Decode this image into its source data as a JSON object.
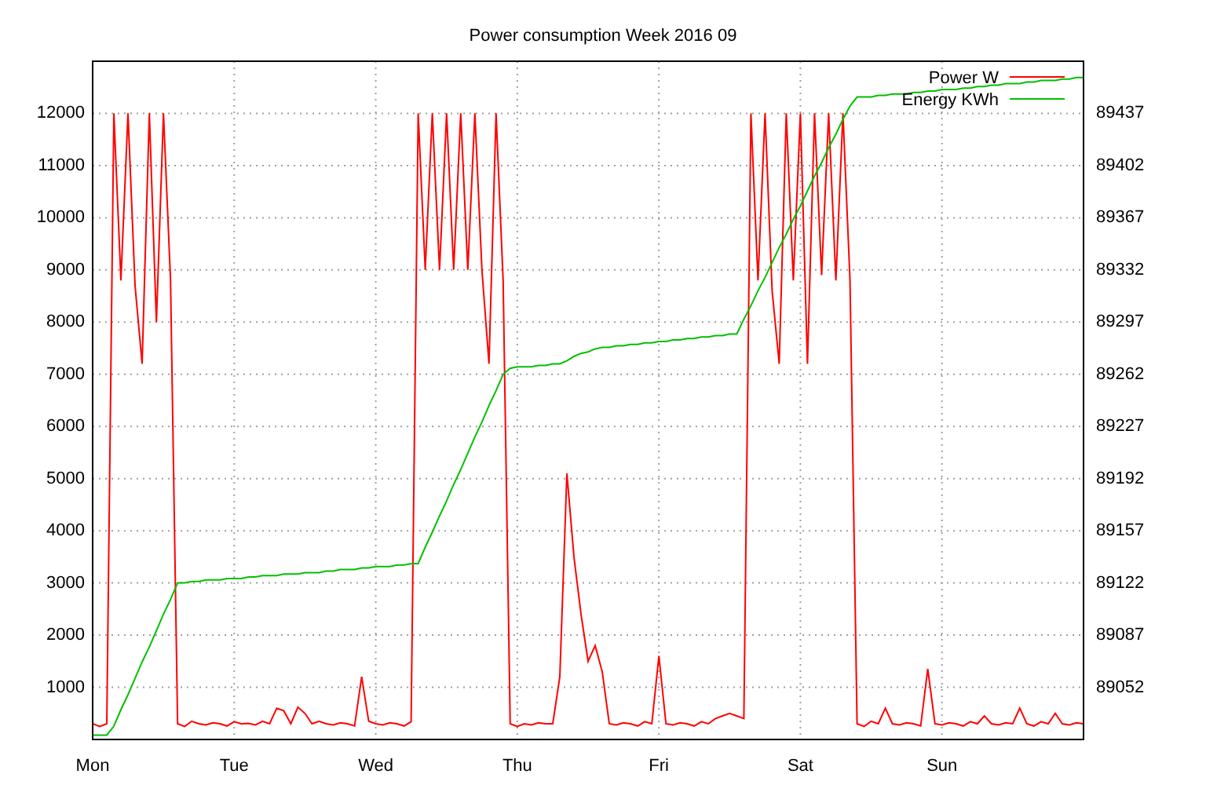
{
  "chart": {
    "title": "Power consumption Week 2016 09",
    "chart_data": {
      "type": "line",
      "ylim": [
        0,
        13000
      ],
      "categories": [
        "Mon",
        null,
        null,
        null,
        null,
        null,
        null,
        null,
        null,
        null,
        null,
        null,
        null,
        null,
        null,
        null,
        null,
        null,
        null,
        null,
        "Tue",
        null,
        null,
        null,
        null,
        null,
        null,
        null,
        null,
        null,
        null,
        null,
        null,
        null,
        null,
        null,
        null,
        null,
        null,
        null,
        "Wed",
        null,
        null,
        null,
        null,
        null,
        null,
        null,
        null,
        null,
        null,
        null,
        null,
        null,
        null,
        null,
        null,
        null,
        null,
        null,
        "Thu",
        null,
        null,
        null,
        null,
        null,
        null,
        null,
        null,
        null,
        null,
        null,
        null,
        null,
        null,
        null,
        null,
        null,
        null,
        null,
        "Fri",
        null,
        null,
        null,
        null,
        null,
        null,
        null,
        null,
        null,
        null,
        null,
        null,
        null,
        null,
        null,
        null,
        null,
        null,
        null,
        "Sat",
        null,
        null,
        null,
        null,
        null,
        null,
        null,
        null,
        null,
        null,
        null,
        null,
        null,
        null,
        null,
        null,
        null,
        null,
        null,
        "Sun",
        null,
        null,
        null,
        null,
        null,
        null,
        null,
        null,
        null,
        null,
        null,
        null,
        null,
        null,
        null,
        null,
        null,
        null,
        null,
        null
      ],
      "yticks": [
        1000,
        2000,
        3000,
        4000,
        5000,
        6000,
        7000,
        8000,
        9000,
        10000,
        11000,
        12000
      ],
      "grid": true,
      "legend": true,
      "y2lim": [
        89017,
        89472
      ],
      "y2ticks": [
        89052,
        89087,
        89122,
        89157,
        89192,
        89227,
        89262,
        89297,
        89332,
        89367,
        89402,
        89437
      ],
      "series": [
        {
          "name": "Power W",
          "color": "#ff0000",
          "axis": "y",
          "values": [
            300,
            250,
            300,
            12000,
            8800,
            12000,
            8700,
            7200,
            12000,
            8000,
            12000,
            8800,
            300,
            250,
            350,
            300,
            280,
            320,
            300,
            260,
            340,
            300,
            310,
            280,
            350,
            300,
            600,
            550,
            300,
            620,
            500,
            300,
            350,
            300,
            280,
            320,
            300,
            260,
            1200,
            350,
            300,
            280,
            320,
            300,
            260,
            340,
            12000,
            9000,
            12000,
            9000,
            12000,
            9000,
            12000,
            9000,
            12000,
            9000,
            7200,
            12000,
            8800,
            300,
            250,
            300,
            280,
            320,
            300,
            300,
            1200,
            5100,
            3500,
            2400,
            1500,
            1800,
            1300,
            300,
            280,
            320,
            300,
            260,
            340,
            300,
            1600,
            300,
            280,
            320,
            300,
            260,
            340,
            300,
            400,
            450,
            500,
            450,
            400,
            12000,
            8800,
            12000,
            8600,
            7200,
            12000,
            8800,
            12000,
            7200,
            12000,
            8900,
            12000,
            8800,
            12000,
            8800,
            300,
            250,
            350,
            300,
            600,
            300,
            280,
            320,
            300,
            260,
            1350,
            300,
            280,
            320,
            300,
            260,
            340,
            300,
            450,
            300,
            280,
            320,
            300,
            600,
            300,
            260,
            340,
            300,
            500,
            300,
            280,
            320,
            300
          ]
        },
        {
          "name": "Energy KWh",
          "color": "#00c000",
          "axis": "y2",
          "values": [
            89020,
            89020,
            89020,
            89026,
            89037,
            89047,
            89058,
            89069,
            89079,
            89090,
            89101,
            89111,
            89122,
            89122,
            89123,
            89123,
            89124,
            89124,
            89124,
            89125,
            89125,
            89125,
            89126,
            89126,
            89127,
            89127,
            89127,
            89128,
            89128,
            89128,
            89129,
            89129,
            89129,
            89130,
            89130,
            89131,
            89131,
            89131,
            89132,
            89132,
            89133,
            89133,
            89133,
            89134,
            89134,
            89135,
            89135,
            89146,
            89156,
            89167,
            89177,
            89188,
            89198,
            89209,
            89220,
            89230,
            89241,
            89251,
            89262,
            89266,
            89267,
            89267,
            89267,
            89268,
            89268,
            89269,
            89269,
            89271,
            89274,
            89276,
            89277,
            89279,
            89280,
            89280,
            89281,
            89281,
            89282,
            89282,
            89283,
            89283,
            89284,
            89284,
            89285,
            89285,
            89286,
            89286,
            89287,
            89287,
            89288,
            89288,
            89289,
            89289,
            89299,
            89308,
            89318,
            89327,
            89337,
            89347,
            89356,
            89366,
            89375,
            89385,
            89395,
            89404,
            89414,
            89423,
            89433,
            89442,
            89448,
            89448,
            89448,
            89449,
            89449,
            89450,
            89450,
            89450,
            89451,
            89451,
            89452,
            89452,
            89453,
            89453,
            89453,
            89454,
            89454,
            89455,
            89455,
            89456,
            89456,
            89457,
            89457,
            89457,
            89458,
            89458,
            89459,
            89459,
            89459,
            89460,
            89460,
            89461,
            89461
          ]
        }
      ]
    }
  }
}
